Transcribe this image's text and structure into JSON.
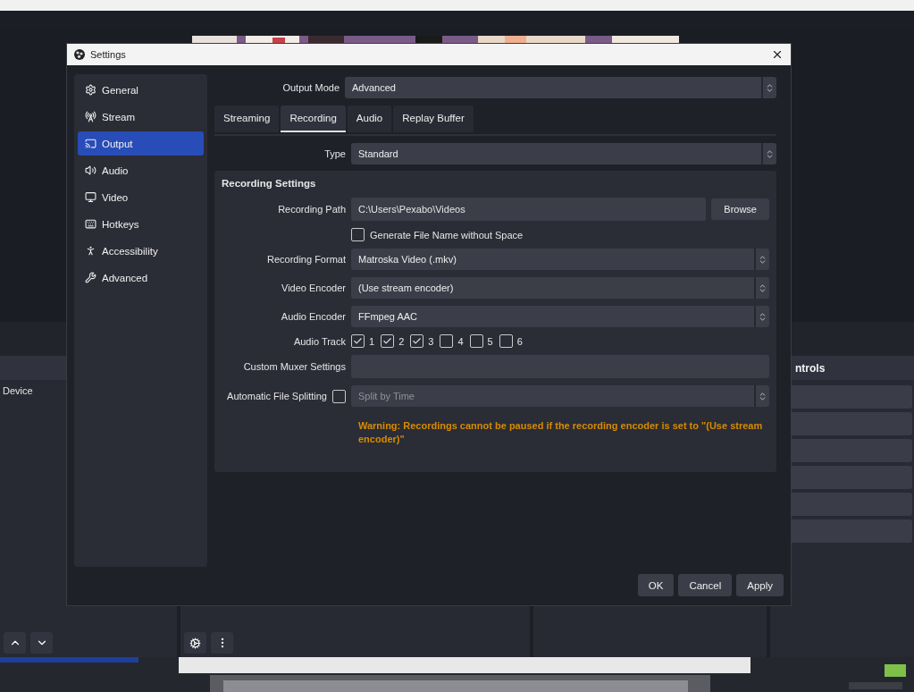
{
  "background": {
    "source_item": "Device",
    "controls_title": "ntrols"
  },
  "dialog": {
    "title": "Settings",
    "sidebar": [
      {
        "label": "General",
        "selected": false
      },
      {
        "label": "Stream",
        "selected": false
      },
      {
        "label": "Output",
        "selected": true
      },
      {
        "label": "Audio",
        "selected": false
      },
      {
        "label": "Video",
        "selected": false
      },
      {
        "label": "Hotkeys",
        "selected": false
      },
      {
        "label": "Accessibility",
        "selected": false
      },
      {
        "label": "Advanced",
        "selected": false
      }
    ],
    "output_mode": {
      "label": "Output Mode",
      "value": "Advanced"
    },
    "tabs": [
      {
        "label": "Streaming",
        "selected": false
      },
      {
        "label": "Recording",
        "selected": true
      },
      {
        "label": "Audio",
        "selected": false
      },
      {
        "label": "Replay Buffer",
        "selected": false
      }
    ],
    "type": {
      "label": "Type",
      "value": "Standard"
    },
    "section": {
      "title": "Recording Settings",
      "rows": [
        {
          "kind": "path",
          "label": "Recording Path",
          "value": "C:\\Users\\Pexabo\\Videos",
          "button": "Browse"
        },
        {
          "kind": "checkbox",
          "label": "Generate File Name without Space",
          "checked": false
        },
        {
          "kind": "select",
          "label": "Recording Format",
          "value": "Matroska Video (.mkv)"
        },
        {
          "kind": "select",
          "label": "Video Encoder",
          "value": "(Use stream encoder)"
        },
        {
          "kind": "select",
          "label": "Audio Encoder",
          "value": "FFmpeg AAC"
        },
        {
          "kind": "tracks",
          "label": "Audio Track",
          "tracks": [
            {
              "label": "1",
              "checked": true
            },
            {
              "label": "2",
              "checked": true
            },
            {
              "label": "3",
              "checked": true
            },
            {
              "label": "4",
              "checked": false
            },
            {
              "label": "5",
              "checked": false
            },
            {
              "label": "6",
              "checked": false
            }
          ]
        },
        {
          "kind": "text",
          "label": "Custom Muxer Settings"
        },
        {
          "kind": "split",
          "label": "Automatic File Splitting",
          "checked": false,
          "value": "Split by Time",
          "disabled": true
        },
        {
          "kind": "warning",
          "text": "Warning: Recordings cannot be paused if the recording encoder is set to \"(Use stream encoder)\""
        }
      ]
    },
    "buttons": [
      "OK",
      "Cancel",
      "Apply"
    ]
  }
}
